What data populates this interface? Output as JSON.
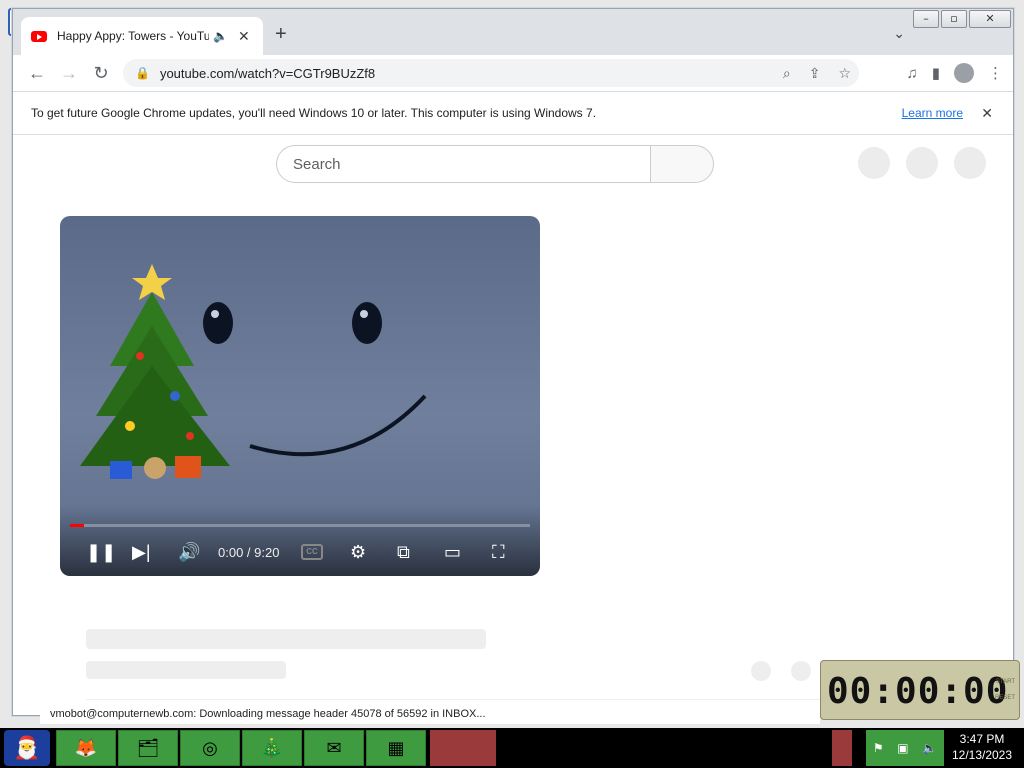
{
  "browser": {
    "tab_title": "Happy Appy: Towers - YouTube",
    "audio_icon": "speaker-icon",
    "url": "youtube.com/watch?v=CGTr9BUzZf8",
    "window_controls": [
      "–",
      "▫",
      "✕"
    ]
  },
  "infobar": {
    "message": "To get future Google Chrome updates, you'll need Windows 10 or later. This computer is using Windows 7.",
    "link": "Learn more"
  },
  "youtube": {
    "search_placeholder": "Search",
    "player": {
      "time": "0:00 / 9:20",
      "progress": 0.03,
      "cc_label": "CC"
    }
  },
  "status_line": "vmobot@computernewb.com: Downloading message header 45078 of 56592 in INBOX...",
  "stopwatch": {
    "display": "00:00:00",
    "start_label": "START",
    "reset_label": "RESET"
  },
  "taskbar": {
    "clock_time": "3:47 PM",
    "clock_date": "12/13/2023"
  }
}
